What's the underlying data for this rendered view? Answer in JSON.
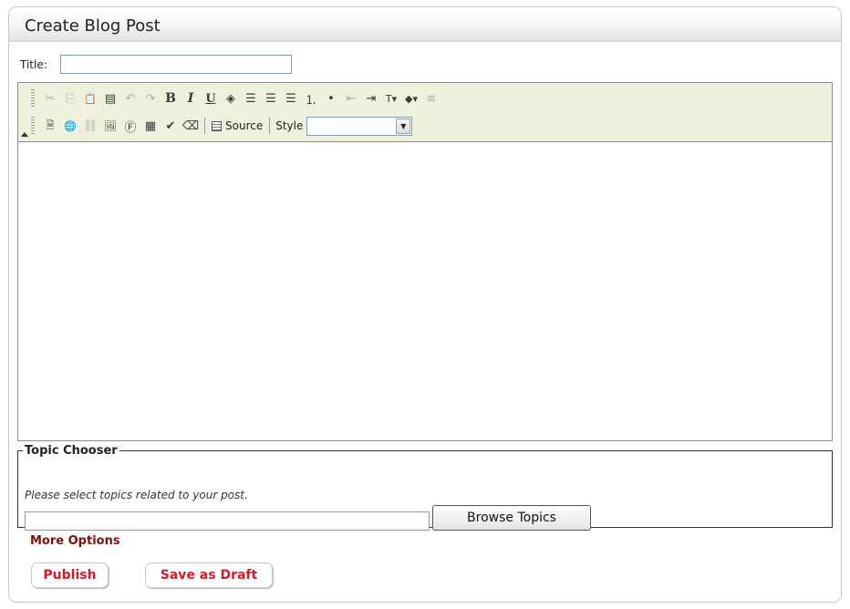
{
  "panel": {
    "title": "Create Blog Post"
  },
  "form": {
    "title_label": "Title:",
    "title_value": ""
  },
  "toolbar": {
    "row1": [
      {
        "icon": "cut-icon",
        "glyph": "✂",
        "enabled": false
      },
      {
        "icon": "copy-icon",
        "glyph": "⎘",
        "enabled": false
      },
      {
        "icon": "paste-icon",
        "glyph": "📋",
        "enabled": true
      },
      {
        "icon": "paste-word-icon",
        "glyph": "▤",
        "enabled": true
      },
      {
        "icon": "undo-icon",
        "glyph": "↶",
        "enabled": false
      },
      {
        "icon": "redo-icon",
        "glyph": "↷",
        "enabled": false
      },
      {
        "icon": "bold-icon",
        "glyph": "B",
        "enabled": true
      },
      {
        "icon": "italic-icon",
        "glyph": "I",
        "enabled": true
      },
      {
        "icon": "underline-icon",
        "glyph": "U",
        "enabled": true
      },
      {
        "icon": "special-char-icon",
        "glyph": "◈",
        "enabled": true
      },
      {
        "icon": "align-left-icon",
        "glyph": "☰",
        "enabled": true
      },
      {
        "icon": "align-center-icon",
        "glyph": "☰",
        "enabled": true
      },
      {
        "icon": "align-right-icon",
        "glyph": "☰",
        "enabled": true
      },
      {
        "icon": "numbered-list-icon",
        "glyph": "⒈",
        "enabled": true
      },
      {
        "icon": "bulleted-list-icon",
        "glyph": "•",
        "enabled": true
      },
      {
        "icon": "outdent-icon",
        "glyph": "⇤",
        "enabled": false
      },
      {
        "icon": "indent-icon",
        "glyph": "⇥",
        "enabled": true
      },
      {
        "icon": "text-color-icon",
        "glyph": "T▾",
        "enabled": true
      },
      {
        "icon": "bg-color-icon",
        "glyph": "◆▾",
        "enabled": true
      },
      {
        "icon": "horizontal-rule-icon",
        "glyph": "≡",
        "enabled": false
      }
    ],
    "row2": [
      {
        "icon": "document-icon",
        "glyph": "🗎",
        "enabled": true
      },
      {
        "icon": "link-icon",
        "glyph": "🌐",
        "enabled": true
      },
      {
        "icon": "unlink-icon",
        "glyph": "⛓",
        "enabled": false
      },
      {
        "icon": "image-icon",
        "glyph": "🖼",
        "enabled": true
      },
      {
        "icon": "flash-icon",
        "glyph": "Ⓕ",
        "enabled": true
      },
      {
        "icon": "table-icon",
        "glyph": "▦",
        "enabled": true
      },
      {
        "icon": "spellcheck-icon",
        "glyph": "✔",
        "enabled": true
      },
      {
        "icon": "eraser-icon",
        "glyph": "⌫",
        "enabled": true
      }
    ],
    "source_label": "Source",
    "style_label": "Style",
    "style_value": ""
  },
  "topic_chooser": {
    "legend": "Topic Chooser",
    "hint": "Please select topics related to your post.",
    "value": "",
    "browse_label": "Browse Topics"
  },
  "more_options": "More Options",
  "actions": {
    "publish": "Publish",
    "save_draft": "Save as Draft"
  }
}
